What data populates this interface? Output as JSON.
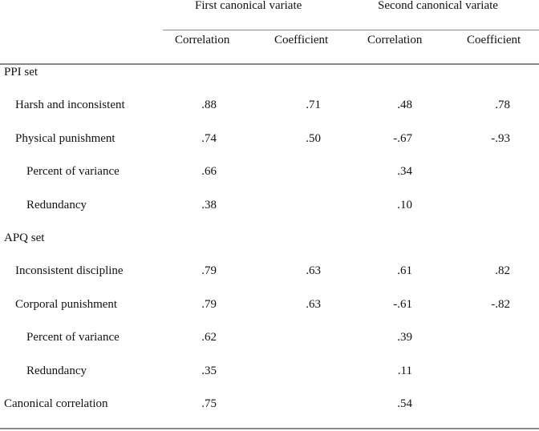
{
  "table": {
    "group_headers": [
      "First canonical variate",
      "Second canonical variate"
    ],
    "column_headers": [
      "Correlation",
      "Coefficient",
      "Correlation",
      "Coefficient"
    ],
    "rows": [
      {
        "label": "PPI set",
        "indent": 0,
        "values": [
          "",
          "",
          "",
          ""
        ]
      },
      {
        "label": "Harsh and inconsistent",
        "indent": 1,
        "values": [
          ".88",
          ".71",
          ".48",
          ".78"
        ]
      },
      {
        "label": "Physical punishment",
        "indent": 1,
        "values": [
          ".74",
          ".50",
          "-.67",
          "-.93"
        ]
      },
      {
        "label": "Percent of variance",
        "indent": 2,
        "values": [
          ".66",
          "",
          ".34",
          ""
        ]
      },
      {
        "label": "Redundancy",
        "indent": 2,
        "values": [
          ".38",
          "",
          ".10",
          ""
        ]
      },
      {
        "label": "APQ set",
        "indent": 0,
        "values": [
          "",
          "",
          "",
          ""
        ]
      },
      {
        "label": "Inconsistent discipline",
        "indent": 1,
        "values": [
          ".79",
          ".63",
          ".61",
          ".82"
        ]
      },
      {
        "label": "Corporal punishment",
        "indent": 1,
        "values": [
          ".79",
          ".63",
          "-.61",
          "-.82"
        ]
      },
      {
        "label": "Percent of variance",
        "indent": 2,
        "values": [
          ".62",
          "",
          ".39",
          ""
        ]
      },
      {
        "label": "Redundancy",
        "indent": 2,
        "values": [
          ".35",
          "",
          ".11",
          ""
        ]
      },
      {
        "label": "Canonical correlation",
        "indent": 0,
        "values": [
          ".75",
          "",
          ".54",
          ""
        ]
      }
    ]
  }
}
